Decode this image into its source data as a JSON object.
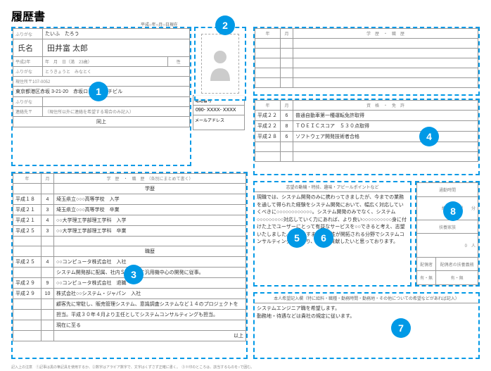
{
  "title": "履歴書",
  "date_line": "平成○年○月○日現在",
  "section1": {
    "furigana_label": "ふりがな",
    "furigana_name": "たいふ　たろう",
    "name_label": "氏名",
    "name": "田井富 太郎",
    "birth_label": "平成2年",
    "birth_detail": "年　月　日（満　23歳）",
    "gender_label": "性",
    "addr_furigana_label": "ふりがな",
    "addr_furigana": "とうきょうと　みなとく",
    "postal": "現住所〒107-0052",
    "address": "東京都港区赤坂 3-21-20　赤坂ロングビーチビル",
    "phone_label": "電話番号",
    "phone": "090- XXXX- XXXX",
    "email_label": "メールアドレス",
    "contact_furigana_label": "ふりがな",
    "contact_label": "連絡先〒",
    "contact_note": "（現住所以外に連絡を希望する場合のみ記入）",
    "contact_value": "同上"
  },
  "section3": {
    "header_year": "年",
    "header_month": "月",
    "header_title": "学　歴　・　職　歴　（各別にまとめて書く）",
    "gakureki_label": "学歴",
    "shokureki_label": "職歴",
    "rows": [
      {
        "y": "平成１８",
        "m": "4",
        "t": "埼玉県立○○○高等学校　入学"
      },
      {
        "y": "平成２１",
        "m": "3",
        "t": "埼玉県立○○○高等学校　卒業"
      },
      {
        "y": "平成２１",
        "m": "4",
        "t": "○○大学理工学部理工学科　入学"
      },
      {
        "y": "平成２５",
        "m": "3",
        "t": "○○大学理工学部理工学科　卒業"
      }
    ],
    "jobs": [
      {
        "y": "平成２５",
        "m": "4",
        "t": "○○コンピュータ株式会社　入社"
      },
      {
        "y": "",
        "m": "",
        "t": "システム開発部に配属、社内ＳＥとして汎用機中心の開発に従事。"
      },
      {
        "y": "平成２９",
        "m": "9",
        "t": "○○コンピュータ株式会社　退職"
      },
      {
        "y": "平成２９",
        "m": "10",
        "t": "株式会社○○システム・ジャパン　入社"
      },
      {
        "y": "",
        "m": "",
        "t": "顧客先に常駐し、販売管理システム、意識調査システムなど１４のプロジェクトを"
      },
      {
        "y": "",
        "m": "",
        "t": "担当。平成３０年４月より主任としてシステムコンサルティングも担当。"
      },
      {
        "y": "",
        "m": "",
        "t": "現在に至る"
      }
    ],
    "end": "以上"
  },
  "section4top": {
    "header_year": "年",
    "header_month": "月",
    "header_title": "学　歴　・　職　歴"
  },
  "section4": {
    "header_year": "年",
    "header_month": "月",
    "header_title": "資　格　・　免　許",
    "rows": [
      {
        "y": "平成２２",
        "m": "6",
        "t": "普通自動車第一種運転免許取得"
      },
      {
        "y": "平成２２",
        "m": "8",
        "t": "ＴＯＥＩＣスコア　５３０点取得"
      },
      {
        "y": "平成２８",
        "m": "6",
        "t": "ソフトウェア開発技術者合格"
      }
    ]
  },
  "section5": {
    "title": "志望の動機・特技、趣味・アピールポイントなど",
    "body": "現職では、システム開発のみに携わってきましたが、今までの業務を通して得られた経験をシステム開発において、幅広く対応していくべきに○○○○○○○○○○○○。システム開発のみでなく、システム○○○○○○○○○対応していく力にあれば、より良い○○○○○○○○○○身に付けた上でユーザーにとって有益なサービスを○○できると考え、志望いたしました。今後ますます特殊性が開拓される分野でシステムコンサルティングに携わり、貴社に貢献したいと思っております。"
  },
  "section6": {
    "title": "通勤時間",
    "time_label": "約　　時間　　分",
    "dependents_label": "扶養家族",
    "dependents_val": "0　人",
    "spouse_label": "配偶者",
    "spouse_support_label": "配偶者の扶養義務",
    "circle": "有・無"
  },
  "section7": {
    "title": "本人希望記入欄（特に給料・職種・勤務時間・勤務地・その他についての希望などがあれば記入）",
    "body1": "システムエンジニア職を希望します。",
    "body2": "勤務地・待遇などは貴社の規定に従います。"
  },
  "badges": {
    "b1": "1",
    "b2": "2",
    "b3": "3",
    "b4": "4",
    "b5": "5",
    "b6": "6",
    "b7": "7",
    "b8": "8"
  },
  "footnote": "記入上の注意　①記事は黒の筆記具を使用するか、②数字はアラビア数字で、文字はくずさず正確に書く。　③※印のところは、該当するものを○で囲む。"
}
